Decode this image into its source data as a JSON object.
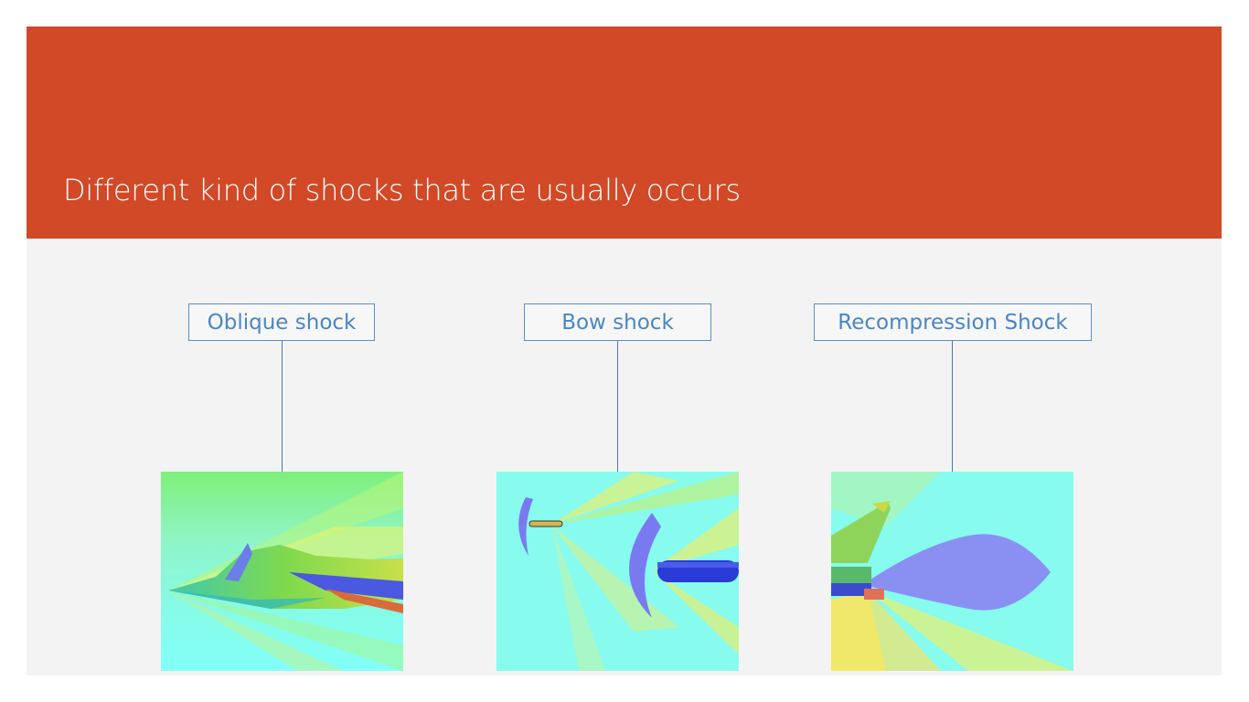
{
  "slide": {
    "title": "Different kind of shocks that are usually occurs"
  },
  "diagram": {
    "items": [
      {
        "label": "Oblique shock",
        "image": "aircraft-cfd-pressure-contour"
      },
      {
        "label": "Bow shock",
        "image": "missile-cfd-pressure-contour"
      },
      {
        "label": "Recompression Shock",
        "image": "tail-jet-cfd-pressure-contour"
      }
    ]
  },
  "colors": {
    "title_band": "#d14926",
    "slide_background": "#f3f3f3",
    "box_border": "#5b8fc9",
    "box_text": "#4a86c5",
    "connector": "#4a74b5"
  }
}
